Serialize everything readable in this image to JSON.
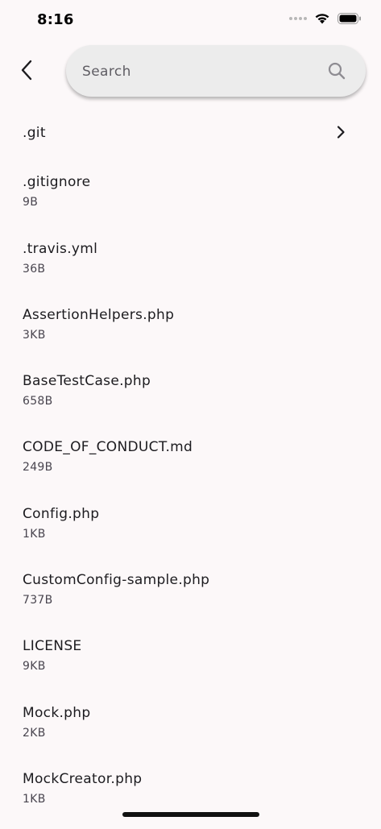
{
  "status_bar": {
    "time": "8:16"
  },
  "header": {
    "back_icon": "chevron-left-icon",
    "search": {
      "placeholder": "Search",
      "value": "",
      "icon": "search-icon"
    }
  },
  "files": [
    {
      "name": ".git",
      "size": "",
      "type": "folder"
    },
    {
      "name": ".gitignore",
      "size": "9B",
      "type": "file"
    },
    {
      "name": ".travis.yml",
      "size": "36B",
      "type": "file"
    },
    {
      "name": "AssertionHelpers.php",
      "size": "3KB",
      "type": "file"
    },
    {
      "name": "BaseTestCase.php",
      "size": "658B",
      "type": "file"
    },
    {
      "name": "CODE_OF_CONDUCT.md",
      "size": "249B",
      "type": "file"
    },
    {
      "name": "Config.php",
      "size": "1KB",
      "type": "file"
    },
    {
      "name": "CustomConfig-sample.php",
      "size": "737B",
      "type": "file"
    },
    {
      "name": "LICENSE",
      "size": "9KB",
      "type": "file"
    },
    {
      "name": "Mock.php",
      "size": "2KB",
      "type": "file"
    },
    {
      "name": "MockCreator.php",
      "size": "1KB",
      "type": "file"
    }
  ],
  "colors": {
    "background": "#fcf8f9",
    "search_background": "#ececec",
    "text_primary": "#1c1b1f",
    "text_secondary": "#49454f"
  }
}
